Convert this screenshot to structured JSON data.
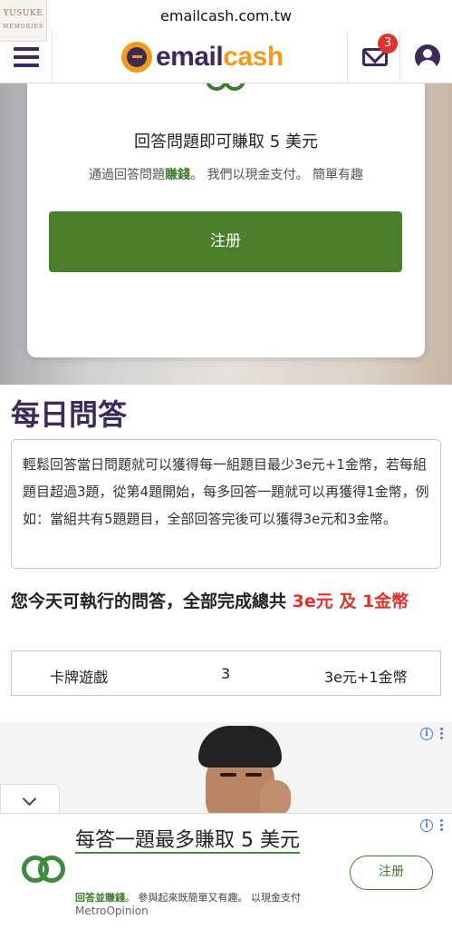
{
  "browser": {
    "url": "emailcash.com.tw"
  },
  "watermark": {
    "line1": "YUSUKE",
    "line2": "MEMORIES"
  },
  "nav": {
    "menu_icon": "hamburger-menu-icon",
    "logo_text_1": "email",
    "logo_text_2": "cash",
    "mail_icon": "envelope-icon",
    "mail_badge": "3",
    "user_icon": "user-circle-icon"
  },
  "hero": {
    "title": "回答問題即可賺取 5 美元",
    "subtitle_pre": "通過回答問題",
    "subtitle_highlight": "賺錢",
    "subtitle_post": "。 我們以現金支付。 簡單有趣",
    "register_label": "注册"
  },
  "daily": {
    "title": "每日問答",
    "description": "輕鬆回答當日問題就可以獲得每一組題目最少3e元+1金幣，若每組題目超過3題，從第4題開始，每多回答一題就可以再獲得1金幣，例如：當組共有5題題目，全部回答完後可以獲得3e元和3金幣。",
    "summary_prefix": "您今天可執行的問答，全部完成總共 ",
    "summary_highlight": "3e元 及 1金幣",
    "table": {
      "name": "卡牌遊戲",
      "count": "3",
      "reward": "3e元+1金幣"
    }
  },
  "ad": {
    "headline": "每答一題最多賺取 5 美元",
    "desc_highlight": "回答並賺錢",
    "desc_rest": "。 參與起來既簡單又有趣。 以現金支付",
    "brand": "MetroOpinion",
    "cta": "注册",
    "colors": {
      "accent_green": "#3d7b2b",
      "brand_purple": "#3b2a5a",
      "brand_orange": "#f39a1c",
      "highlight_red": "#e1322c"
    }
  }
}
